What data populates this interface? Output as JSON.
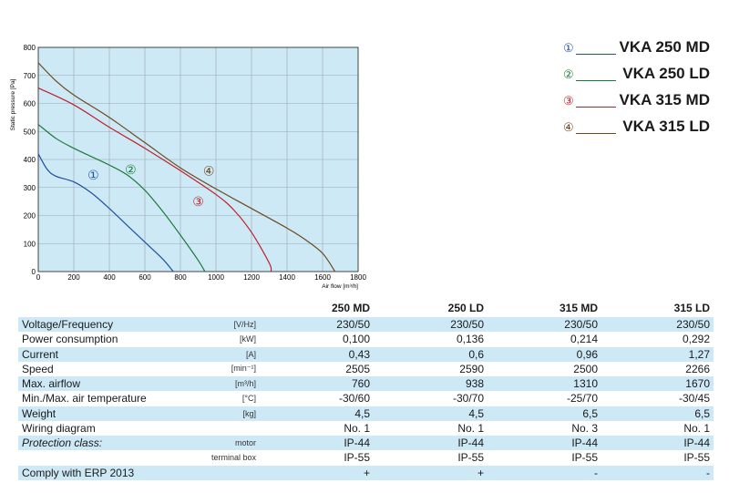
{
  "chart_data": {
    "type": "line",
    "xlabel": "Air flow [m³/h]",
    "ylabel": "Static pressure [Pa]",
    "xlim": [
      0,
      1800
    ],
    "ylim": [
      0,
      800
    ],
    "xticks": [
      "0",
      "200",
      "400",
      "600",
      "800",
      "1000",
      "1200",
      "1400",
      "1600",
      "1800"
    ],
    "yticks": [
      "0",
      "100",
      "200",
      "300",
      "400",
      "500",
      "600",
      "700",
      "800"
    ],
    "grid": true,
    "background": "#cde9f6",
    "series": [
      {
        "marker": "①",
        "color": "#1f4fa0",
        "label_at": [
          310,
          345
        ],
        "x": [
          0,
          50,
          100,
          200,
          300,
          400,
          500,
          600,
          700,
          760
        ],
        "y": [
          420,
          365,
          340,
          320,
          280,
          225,
          165,
          105,
          45,
          0
        ]
      },
      {
        "marker": "②",
        "color": "#1e7a3a",
        "label_at": [
          520,
          365
        ],
        "x": [
          0,
          100,
          200,
          300,
          400,
          500,
          600,
          700,
          800,
          900,
          938
        ],
        "y": [
          525,
          475,
          440,
          410,
          380,
          345,
          290,
          215,
          130,
          40,
          0
        ]
      },
      {
        "marker": "③",
        "color": "#c0202a",
        "label_at": [
          900,
          250
        ],
        "x": [
          0,
          200,
          400,
          600,
          800,
          1000,
          1100,
          1200,
          1300,
          1310
        ],
        "y": [
          655,
          595,
          515,
          440,
          360,
          275,
          220,
          140,
          30,
          0
        ]
      },
      {
        "marker": "④",
        "color": "#6b4a1e",
        "label_at": [
          960,
          360
        ],
        "x": [
          0,
          100,
          200,
          400,
          600,
          800,
          1000,
          1200,
          1400,
          1500,
          1600,
          1670
        ],
        "y": [
          745,
          680,
          630,
          550,
          460,
          370,
          295,
          225,
          155,
          115,
          65,
          0
        ]
      }
    ]
  },
  "legend": [
    {
      "marker": "①",
      "label": "VKA 250 MD",
      "color": "#1f4fa0"
    },
    {
      "marker": "②",
      "label": "VKA 250 LD",
      "color": "#1e7a3a"
    },
    {
      "marker": "③",
      "label": "VKA 315 MD",
      "color": "#c0202a"
    },
    {
      "marker": "④",
      "label": "VKA 315 LD",
      "color": "#6b4a1e"
    }
  ],
  "table": {
    "columns": [
      "250 MD",
      "250 LD",
      "315 MD",
      "315 LD"
    ],
    "rows": [
      {
        "label": "Voltage/Frequency",
        "unit": "[V/Hz]",
        "values": [
          "230/50",
          "230/50",
          "230/50",
          "230/50"
        ]
      },
      {
        "label": "Power consumption",
        "unit": "[kW]",
        "values": [
          "0,100",
          "0,136",
          "0,214",
          "0,292"
        ]
      },
      {
        "label": "Current",
        "unit": "[A]",
        "values": [
          "0,43",
          "0,6",
          "0,96",
          "1,27"
        ]
      },
      {
        "label": "Speed",
        "unit": "[min⁻¹]",
        "values": [
          "2505",
          "2590",
          "2500",
          "2266"
        ]
      },
      {
        "label": "Max. airflow",
        "unit": "[m³/h]",
        "values": [
          "760",
          "938",
          "1310",
          "1670"
        ]
      },
      {
        "label": "Min./Max. air temperature",
        "unit": "[°C]",
        "values": [
          "-30/60",
          "-30/70",
          "-25/70",
          "-30/45"
        ]
      },
      {
        "label": "Weight",
        "unit": "[kg]",
        "values": [
          "4,5",
          "4,5",
          "6,5",
          "6,5"
        ]
      },
      {
        "label": "Wiring diagram",
        "unit": "",
        "values": [
          "No. 1",
          "No. 1",
          "No. 3",
          "No. 1"
        ]
      },
      {
        "label": "Protection class:",
        "unit": "motor",
        "italic": true,
        "values": [
          "IP-44",
          "IP-44",
          "IP-44",
          "IP-44"
        ]
      },
      {
        "label": "",
        "unit": "terminal box",
        "values": [
          "IP-55",
          "IP-55",
          "IP-55",
          "IP-55"
        ]
      },
      {
        "label": "Comply with ERP 2013",
        "unit": "",
        "values": [
          "+",
          "+",
          "-",
          "-"
        ]
      }
    ]
  }
}
